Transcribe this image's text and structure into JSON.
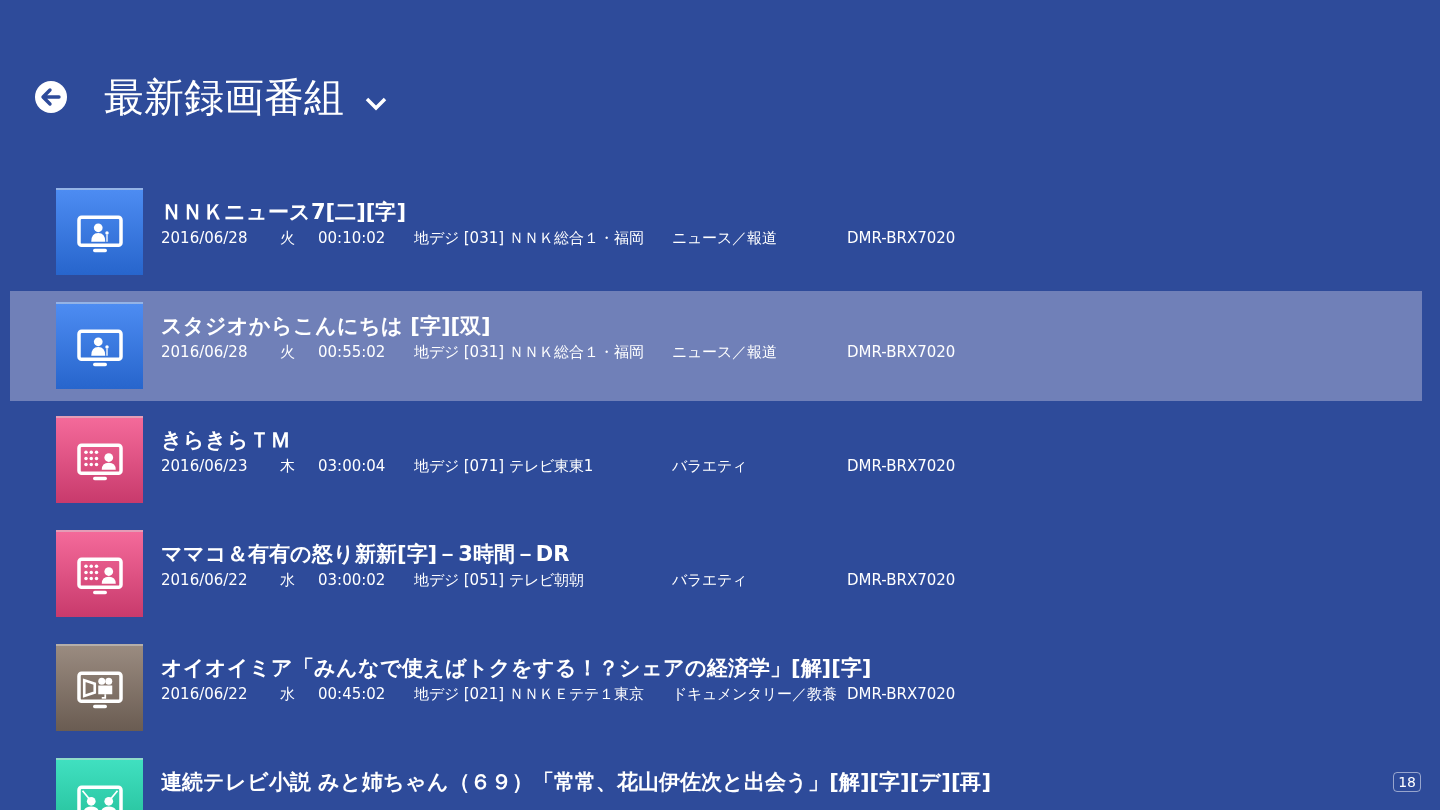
{
  "header": {
    "title": "最新録画番組"
  },
  "recordings": [
    {
      "kind": "news",
      "selected": false,
      "title": "ＮＮＫニュース7[二][字]",
      "date": "2016/06/28",
      "weekday": "火",
      "duration": "00:10:02",
      "channel": "地デジ [031] ＮＮＫ総合１・福岡",
      "genre": "ニュース／報道",
      "device": "DMR-BRX7020"
    },
    {
      "kind": "news",
      "selected": true,
      "title": "スタジオからこんにちは  [字][双]",
      "date": "2016/06/28",
      "weekday": "火",
      "duration": "00:55:02",
      "channel": "地デジ [031] ＮＮＫ総合１・福岡",
      "genre": "ニュース／報道",
      "device": "DMR-BRX7020"
    },
    {
      "kind": "variety",
      "selected": false,
      "title": "きらきらＴＭ",
      "date": "2016/06/23",
      "weekday": "木",
      "duration": "03:00:04",
      "channel": "地デジ [071] テレビ東東1",
      "genre": "バラエティ",
      "device": "DMR-BRX7020"
    },
    {
      "kind": "variety",
      "selected": false,
      "title": "ママコ＆有有の怒り新新[字]－3時間－DR",
      "date": "2016/06/22",
      "weekday": "水",
      "duration": "03:00:02",
      "channel": "地デジ [051] テレビ朝朝",
      "genre": "バラエティ",
      "device": "DMR-BRX7020"
    },
    {
      "kind": "documentary",
      "selected": false,
      "title": "オイオイミア「みんなで使えばトクをする！？シェアの経済学」[解][字]",
      "date": "2016/06/22",
      "weekday": "水",
      "duration": "00:45:02",
      "channel": "地デジ [021] ＮＮＫＥテテ１東京",
      "genre": "ドキュメンタリー／教養",
      "device": "DMR-BRX7020"
    },
    {
      "kind": "drama",
      "selected": false,
      "title": "連続テレビ小説  みと姉ちゃん（６９）「常常、花山伊佐次と出会う」[解][字][デ][再]"
    }
  ],
  "page_count": "18"
}
